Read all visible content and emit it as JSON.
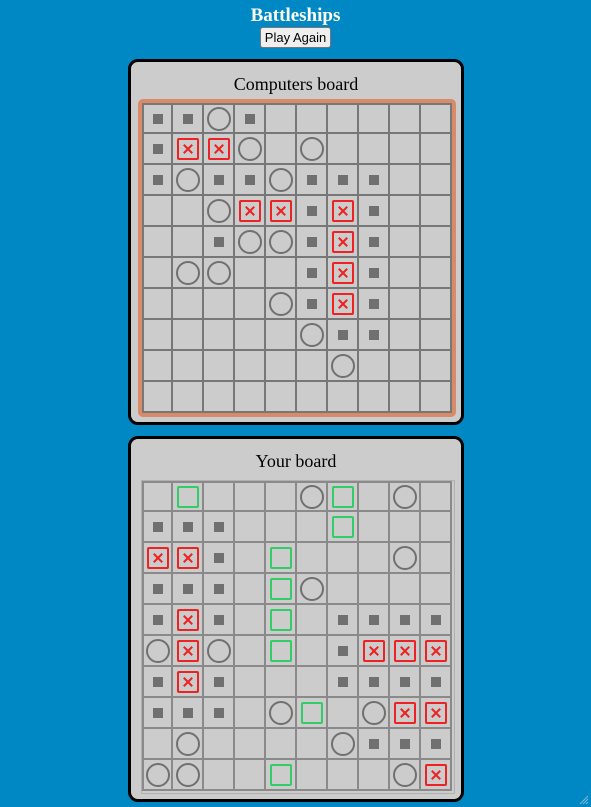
{
  "header": {
    "title": "Battleships",
    "play_again_label": "Play Again"
  },
  "computer_board": {
    "title": "Computers board",
    "rows": [
      "..o.......",
      ".xxo.o....",
      ".o..o.....",
      "..oxx.x...",
      "...oo.x...",
      ".oo...x...",
      "....o.x...",
      ".....o....",
      "......o...",
      ".........."
    ],
    "row_masks": [
      "..o.......",
      ".xxo.o....",
      ".o..o.....",
      "..oxx.x...",
      "...oo.x...",
      ".oo...x...",
      "....o.x...",
      ".....o....",
      "......o...",
      ".........."
    ],
    "grid": [
      [
        "dot",
        "dot",
        "miss",
        "dot",
        "",
        "",
        "",
        "",
        "",
        ""
      ],
      [
        "dot",
        "hit",
        "hit",
        "miss",
        "",
        "miss",
        "",
        "",
        "",
        ""
      ],
      [
        "dot",
        "miss",
        "dot",
        "dot",
        "miss",
        "dot",
        "dot",
        "dot",
        "",
        ""
      ],
      [
        "",
        "",
        "miss",
        "hit",
        "hit",
        "dot",
        "hit",
        "dot",
        "",
        ""
      ],
      [
        "",
        "",
        "dot",
        "miss",
        "miss",
        "dot",
        "hit",
        "dot",
        "",
        ""
      ],
      [
        "",
        "miss",
        "miss",
        "",
        "",
        "dot",
        "hit",
        "dot",
        "",
        ""
      ],
      [
        "",
        "",
        "",
        "",
        "miss",
        "dot",
        "hit",
        "dot",
        "",
        ""
      ],
      [
        "",
        "",
        "",
        "",
        "",
        "miss",
        "dot",
        "dot",
        "",
        ""
      ],
      [
        "",
        "",
        "",
        "",
        "",
        "",
        "miss",
        "",
        "",
        ""
      ],
      [
        "",
        "",
        "",
        "",
        "",
        "",
        "",
        "",
        "",
        ""
      ]
    ]
  },
  "player_board": {
    "title": "Your board",
    "grid": [
      [
        "",
        "ship",
        "",
        "",
        "",
        "miss",
        "ship",
        "",
        "miss",
        ""
      ],
      [
        "dot",
        "dot",
        "dot",
        "",
        "",
        "",
        "ship",
        "",
        "",
        ""
      ],
      [
        "hit",
        "hit",
        "dot",
        "",
        "ship",
        "",
        "",
        "",
        "miss",
        ""
      ],
      [
        "dot",
        "dot",
        "dot",
        "",
        "ship",
        "miss",
        "",
        "",
        "",
        ""
      ],
      [
        "dot",
        "hit",
        "dot",
        "",
        "ship",
        "",
        "dot",
        "dot",
        "dot",
        "dot"
      ],
      [
        "miss",
        "hit",
        "miss",
        "",
        "ship",
        "",
        "dot",
        "hit",
        "hit",
        "hit"
      ],
      [
        "dot",
        "hit",
        "dot",
        "",
        "",
        "",
        "dot",
        "dot",
        "dot",
        "dot"
      ],
      [
        "dot",
        "dot",
        "dot",
        "",
        "miss",
        "ship",
        "",
        "miss",
        "hit",
        "hit"
      ],
      [
        "",
        "miss",
        "",
        "",
        "",
        "",
        "miss",
        "dot",
        "dot",
        "dot"
      ],
      [
        "miss",
        "miss",
        "",
        "",
        "ship",
        "",
        "",
        "",
        "miss",
        "hit"
      ]
    ]
  },
  "colors": {
    "background": "#0088c5",
    "board_bg": "#cccccc",
    "hit": "#ee2222",
    "ship": "#33cc66",
    "miss": "#707070",
    "target_frame": "#d98a66"
  },
  "icons": {
    "hit": "x-box-icon",
    "miss": "circle-icon",
    "adjacent": "square-dot-icon",
    "ship": "ship-segment-icon"
  }
}
